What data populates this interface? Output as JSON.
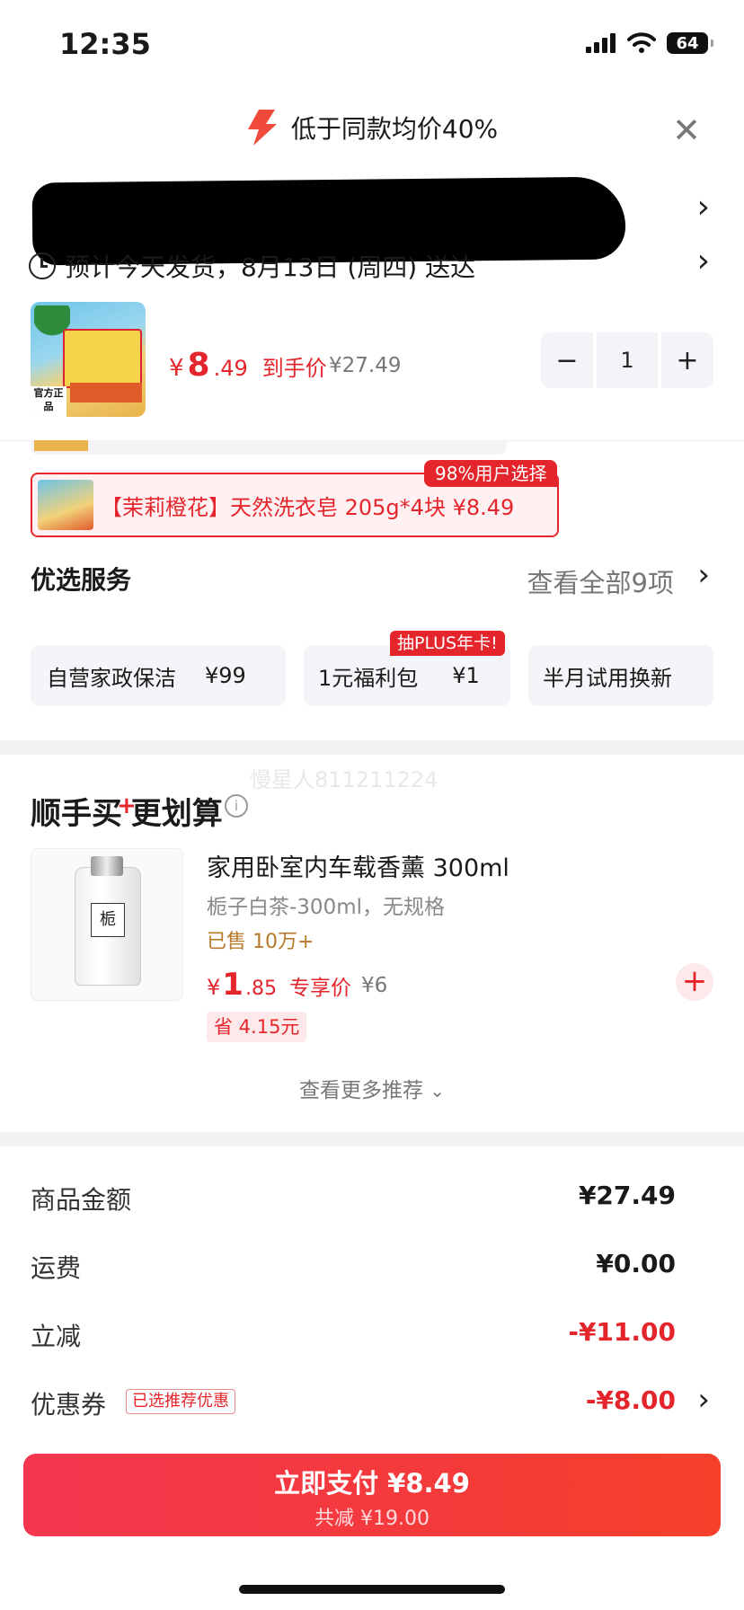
{
  "status_bar": {
    "time": "12:35",
    "battery": "64"
  },
  "header": {
    "banner_text": "低于同款均价40%"
  },
  "delivery": {
    "text": "预计今天发货，8月13日 (周四) 送达"
  },
  "product": {
    "image_tag": "官方正品",
    "price_currency": "¥",
    "price_int": "8",
    "price_dec": ".49",
    "price_label": "到手价",
    "original_price": "¥27.49",
    "quantity": "1"
  },
  "recommended_choice": {
    "badge": "98%用户选择",
    "text": "【茉莉橙花】天然洗衣皂 205g*4块  ¥8.49"
  },
  "services": {
    "title": "优选服务",
    "view_all": "查看全部9项",
    "plus_badge": "抽PLUS年卡!",
    "items": [
      {
        "name": "自营家政保洁",
        "price": "¥99"
      },
      {
        "name": "1元福利包",
        "price": "¥1"
      },
      {
        "name": "半月试用换新",
        "price": ""
      }
    ]
  },
  "watermark": "慢星人811211224",
  "addon": {
    "title_left": "顺手买",
    "title_plus": "+",
    "title_right": "更划算",
    "name": "家用卧室内车载香薰 300ml",
    "spec": "栀子白茶-300ml，无规格",
    "sold": "已售 10万+",
    "price_currency": "¥",
    "price_int": "1",
    "price_dec": ".85",
    "price_label": "专享价",
    "original_price": "¥6",
    "save": "省 4.15元",
    "bottle_label": "栀",
    "more": "查看更多推荐"
  },
  "summary": {
    "goods_label": "商品金额",
    "goods_value": "¥27.49",
    "shipping_label": "运费",
    "shipping_value": "¥0.00",
    "discount_label": "立减",
    "discount_value": "-¥11.00",
    "coupon_label": "优惠券",
    "coupon_tag": "已选推荐优惠",
    "coupon_value": "-¥8.00"
  },
  "pay": {
    "label": "立即支付 ¥8.49",
    "sub": "共减 ¥19.00"
  },
  "colors": {
    "accent": "#e4262c",
    "gold": "#b8792a"
  }
}
